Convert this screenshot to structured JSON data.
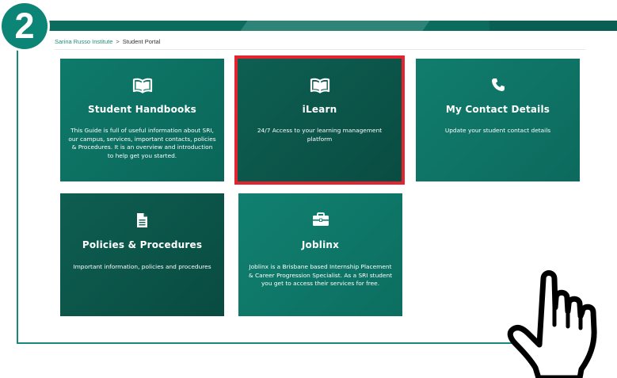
{
  "step": {
    "number": "2"
  },
  "breadcrumb": {
    "home": "Sarina Russo Institute",
    "separator": ">",
    "current": "Student Portal"
  },
  "tiles": [
    {
      "title": "Student Handbooks",
      "description": "This Guide is full of useful information about SRI, our campus, services, important contacts, policies & Procedures. It is an overview and introduction to help get you started.",
      "icon": "book-icon"
    },
    {
      "title": "iLearn",
      "description": "24/7 Access to your learning management platform",
      "icon": "book-icon"
    },
    {
      "title": "My Contact Details",
      "description": "Update your student contact details",
      "icon": "phone-icon"
    },
    {
      "title": "Policies & Procedures",
      "description": "Important information, policies and procedures",
      "icon": "document-icon"
    },
    {
      "title": "Joblinx",
      "description": "Joblinx is a Brisbane based Internship Placement & Career Progression Specialist. As a SRI student you get to access their services for free.",
      "icon": "briefcase-icon"
    }
  ],
  "colors": {
    "brand_teal": "#0f7a6a",
    "dark_teal": "#094c42",
    "highlight_red": "#e3232f",
    "link": "#1e8c7d"
  }
}
